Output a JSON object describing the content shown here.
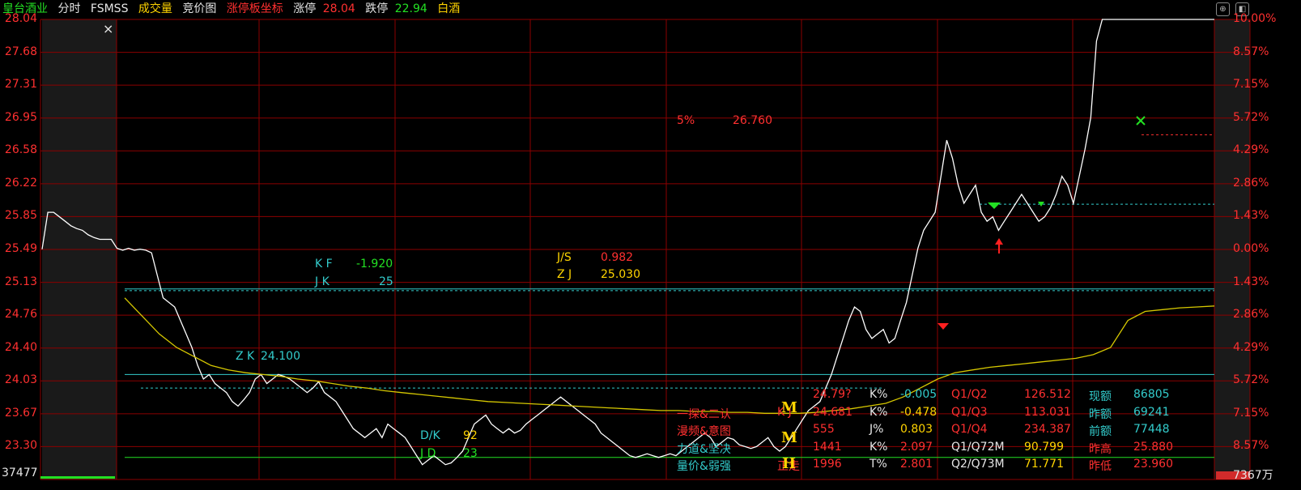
{
  "header": {
    "stock_name": "皇台酒业",
    "tab_intraday": "分时",
    "indicator": "FSMSS",
    "volume": "成交量",
    "auction": "竞价图",
    "limit_coord": "涨停板坐标",
    "limit_up_label": "涨停",
    "limit_up_value": "28.04",
    "limit_down_label": "跌停",
    "limit_down_value": "22.94",
    "sector": "白酒",
    "icon_a": "expand-icon",
    "icon_b": "window-icon"
  },
  "axis": {
    "left": [
      "28.04",
      "27.68",
      "27.31",
      "26.95",
      "26.58",
      "26.22",
      "25.85",
      "25.49",
      "25.13",
      "24.76",
      "24.40",
      "24.03",
      "23.67",
      "23.30",
      "37477"
    ],
    "right": [
      "10.00%",
      "8.57%",
      "7.15%",
      "5.72%",
      "4.29%",
      "2.86%",
      "1.43%",
      "0.00%",
      "1.43%",
      "2.86%",
      "4.29%",
      "5.72%",
      "7.15%",
      "8.57%",
      "7367万"
    ]
  },
  "annotations": {
    "kf_label": "K F",
    "kf_value": "-1.920",
    "jk_label": "J K",
    "jk_value": "25",
    "js_label": "J/S",
    "js_value": "0.982",
    "zj_label": "Z J",
    "zj_value": "25.030",
    "zk_label": "Z K",
    "zk_value": "24.100",
    "dk_label": "D/K",
    "dk_value": "92",
    "jd_label": "J D",
    "jd_value": "23",
    "pct_label": "5%",
    "pct_value": "26.760",
    "close_x": "×"
  },
  "panel": {
    "col1": [
      "一探&二认",
      "漫频&意图",
      "力道&坚决",
      "量价&弱强"
    ],
    "col2_label": [
      "",
      "K J",
      "",
      "",
      ""
    ],
    "col2_val": [
      "24.79?",
      "24.681",
      "555",
      "1441",
      "1996"
    ],
    "col2_sym": [
      "",
      "",
      "",
      "",
      "正走"
    ],
    "col3_label": [
      "K%",
      "K%",
      "J%",
      "K%",
      "T%"
    ],
    "col3_val": [
      "-0.005",
      "-0.478",
      "0.803",
      "2.097",
      "2.801"
    ],
    "col4_label": [
      "Q1/Q2",
      "Q1/Q3",
      "Q1/Q4",
      "Q1/Q72M",
      "Q2/Q73M"
    ],
    "col4_val": [
      "126.512",
      "113.031",
      "234.387",
      "90.799",
      "71.771"
    ],
    "col5_label": [
      "现额",
      "昨额",
      "前额",
      "昨高",
      "昨低"
    ],
    "col5_val": [
      "86805",
      "69241",
      "77448",
      "25.880",
      "23.960"
    ]
  },
  "chart_data": {
    "type": "line",
    "title": "",
    "ylim": [
      23.3,
      28.04
    ],
    "prev_close": 25.49,
    "series": [
      {
        "values": [
          25.49,
          25.9,
          25.9,
          25.85,
          25.8,
          25.75,
          25.72,
          25.7,
          25.65,
          25.62,
          25.6,
          25.6,
          25.6,
          25.5,
          25.48,
          25.5,
          25.48,
          25.49,
          25.48,
          25.45,
          25.2,
          24.95,
          24.9,
          24.85,
          24.7,
          24.55,
          24.4,
          24.2,
          24.05,
          24.1,
          24.0,
          23.95,
          23.9,
          23.8,
          23.75,
          23.82,
          23.9,
          24.05,
          24.1,
          24.0,
          24.05,
          24.1,
          24.08,
          24.05,
          24.0,
          23.95,
          23.9,
          23.95,
          24.02,
          23.9,
          23.85,
          23.8,
          23.7,
          23.6,
          23.5,
          23.45,
          23.4,
          23.45,
          23.5,
          23.4,
          23.55,
          23.5,
          23.45,
          23.4,
          23.3,
          23.2,
          23.1,
          23.15,
          23.2,
          23.15,
          23.1,
          23.12,
          23.18,
          23.25,
          23.4,
          23.55,
          23.6,
          23.65,
          23.55,
          23.5,
          23.45,
          23.5,
          23.45,
          23.48,
          23.55,
          23.6,
          23.65,
          23.7,
          23.75,
          23.8,
          23.85,
          23.8,
          23.75,
          23.7,
          23.65,
          23.6,
          23.55,
          23.45,
          23.4,
          23.35,
          23.3,
          23.25,
          23.2,
          23.18,
          23.2,
          23.22,
          23.2,
          23.18,
          23.2,
          23.22,
          23.2,
          23.25,
          23.3,
          23.35,
          23.4,
          23.45,
          23.4,
          23.3,
          23.35,
          23.4,
          23.38,
          23.32,
          23.3,
          23.28,
          23.3,
          23.35,
          23.4,
          23.3,
          23.25,
          23.3,
          23.4,
          23.5,
          23.6,
          23.7,
          23.75,
          23.8,
          23.95,
          24.1,
          24.3,
          24.5,
          24.7,
          24.85,
          24.8,
          24.6,
          24.5,
          24.55,
          24.6,
          24.45,
          24.5,
          24.7,
          24.9,
          25.2,
          25.5,
          25.7,
          25.8,
          25.9,
          26.3,
          26.7,
          26.5,
          26.2,
          26.0,
          26.1,
          26.2,
          25.9,
          25.8,
          25.85,
          25.7,
          25.8,
          25.9,
          26.0,
          26.1,
          26.0,
          25.9,
          25.8,
          25.85,
          25.95,
          26.1,
          26.3,
          26.2,
          26.0,
          26.3,
          26.6,
          26.95,
          27.8,
          28.04,
          28.04,
          28.04,
          28.04,
          28.04
        ]
      },
      {
        "values": [
          24.95,
          24.75,
          24.55,
          24.4,
          24.3,
          24.2,
          24.15,
          24.12,
          24.1,
          24.08,
          24.05,
          24.03,
          24.0,
          23.97,
          23.95,
          23.92,
          23.9,
          23.88,
          23.86,
          23.84,
          23.82,
          23.8,
          23.79,
          23.78,
          23.77,
          23.76,
          23.75,
          23.74,
          23.73,
          23.72,
          23.71,
          23.7,
          23.7,
          23.69,
          23.69,
          23.68,
          23.68,
          23.67,
          23.67,
          23.67,
          23.68,
          23.7,
          23.72,
          23.75,
          23.78,
          23.85,
          23.95,
          24.05,
          24.12,
          24.15,
          24.18,
          24.2,
          24.22,
          24.24,
          24.26,
          24.28,
          24.32,
          24.4,
          24.7,
          24.8,
          24.82,
          24.84,
          24.85,
          24.86
        ]
      }
    ]
  }
}
